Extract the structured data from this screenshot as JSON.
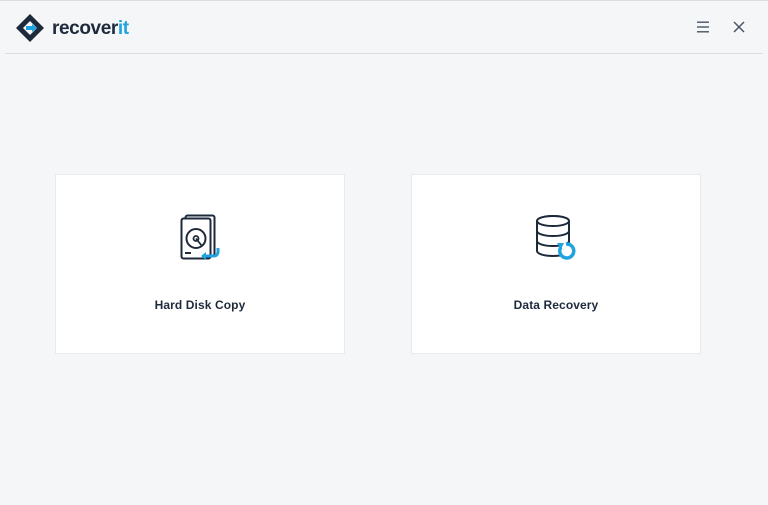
{
  "app": {
    "logo_text_main": "recover",
    "logo_text_accent": "it",
    "brand_color": "#1fa4e0",
    "text_color": "#1e2a3b"
  },
  "titlebar": {
    "menu_icon": "hamburger-menu-icon",
    "close_icon": "close-icon"
  },
  "options": [
    {
      "label": "Hard Disk Copy",
      "icon": "hard-disk-copy-icon"
    },
    {
      "label": "Data Recovery",
      "icon": "data-recovery-icon"
    }
  ]
}
